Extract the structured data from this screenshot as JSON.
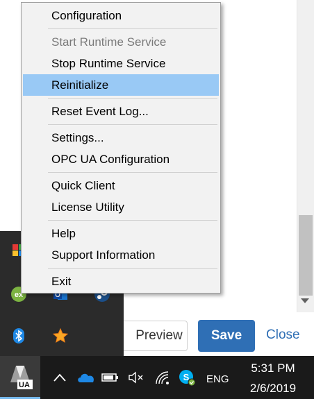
{
  "menu": {
    "items": [
      {
        "label": "Configuration",
        "state": "normal"
      },
      {
        "label": "Start Runtime Service",
        "state": "disabled"
      },
      {
        "label": "Stop Runtime Service",
        "state": "normal"
      },
      {
        "label": "Reinitialize",
        "state": "highlighted"
      },
      {
        "label": "Reset Event Log...",
        "state": "normal"
      },
      {
        "label": "Settings...",
        "state": "normal"
      },
      {
        "label": "OPC UA Configuration",
        "state": "normal"
      },
      {
        "label": "Quick Client",
        "state": "normal"
      },
      {
        "label": "License Utility",
        "state": "normal"
      },
      {
        "label": "Help",
        "state": "normal"
      },
      {
        "label": "Support Information",
        "state": "normal"
      },
      {
        "label": "Exit",
        "state": "normal"
      }
    ]
  },
  "toolbar": {
    "preview_label": "Preview",
    "save_label": "Save",
    "close_label": "Close"
  },
  "taskbar": {
    "app_badge": "UA",
    "language": "ENG",
    "time": "5:31 PM",
    "date": "2/6/2019"
  },
  "tray_popup": {
    "icons": [
      "app-tray-icon",
      "ex-tray-icon",
      "outlook-icon",
      "steam-icon",
      "bluetooth-icon",
      "star-icon"
    ]
  },
  "colors": {
    "accent": "#2f6fb5",
    "highlight": "#99c9f5",
    "menu_bg": "#f2f2f2",
    "taskbar_bg": "#1a1a1a",
    "tray_popup_bg": "#2b2b2b"
  }
}
